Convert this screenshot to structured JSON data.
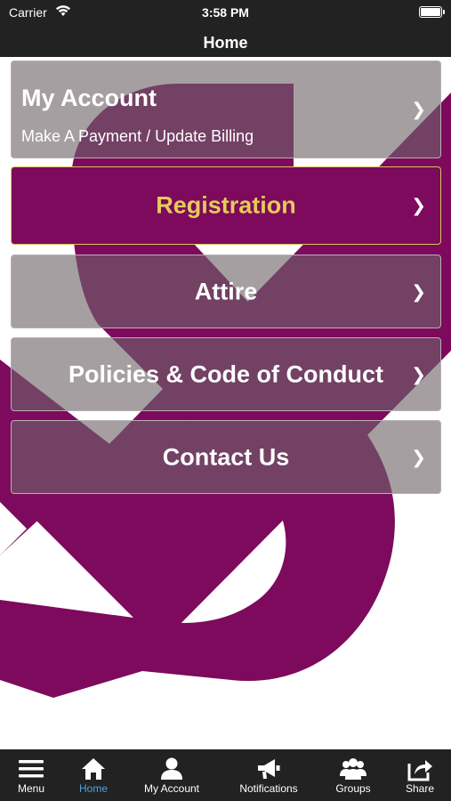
{
  "status_bar": {
    "carrier": "Carrier",
    "time": "3:58 PM"
  },
  "nav": {
    "title": "Home"
  },
  "menu": {
    "account": {
      "title": "My Account",
      "subtitle": "Make A Payment / Update Billing"
    },
    "registration": "Registration",
    "attire": "Attire",
    "policies": "Policies & Code of Conduct",
    "contact": "Contact Us",
    "chevron": "❯"
  },
  "colors": {
    "brand_purple": "#7d0a5c",
    "registration_text": "#e4cb59",
    "active_tab": "#4aa3e0",
    "bar_bg": "#222222"
  },
  "tabs": [
    {
      "label": "Menu",
      "icon": "hamburger-icon"
    },
    {
      "label": "Home",
      "icon": "home-icon",
      "active": true
    },
    {
      "label": "My Account",
      "icon": "user-icon"
    },
    {
      "label": "Notifications",
      "icon": "megaphone-icon"
    },
    {
      "label": "Groups",
      "icon": "group-icon"
    },
    {
      "label": "Share",
      "icon": "share-icon"
    }
  ]
}
